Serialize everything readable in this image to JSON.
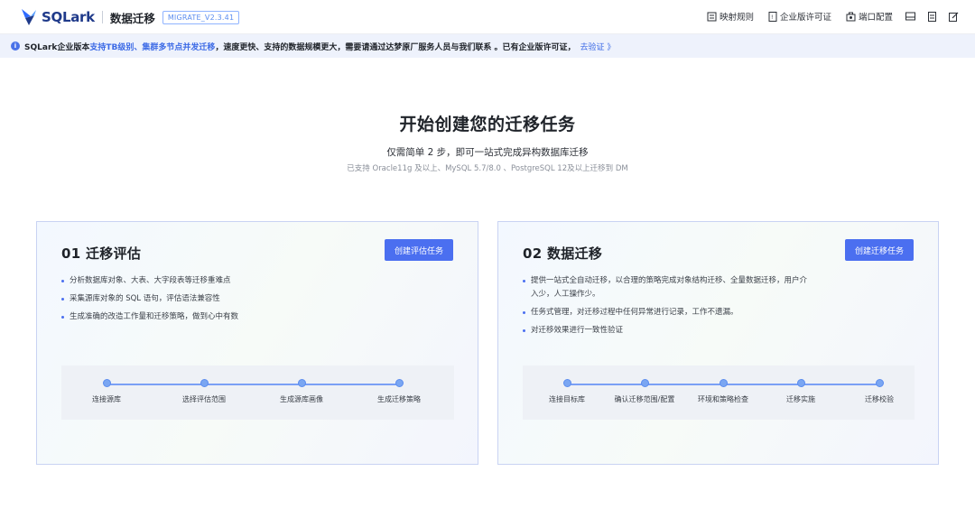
{
  "header": {
    "logo_text": "SQLark",
    "product_name": "数据迁移",
    "version": "MIGRATE_V2.3.41",
    "actions": [
      {
        "label": "映射规则",
        "icon": "mapping-rules-icon"
      },
      {
        "label": "企业版许可证",
        "icon": "license-icon"
      },
      {
        "label": "端口配置",
        "icon": "port-config-icon"
      }
    ],
    "icon_actions": [
      "storage-icon",
      "document-icon",
      "edit-icon"
    ]
  },
  "banner": {
    "prefix": "SQLark企业版本",
    "highlight": "支持TB级别、集群多节点并发迁移",
    "middle": "，速度更快、支持的数据规模更大，需要请通过达梦原厂服务人员与我们联系 。已有企业版许可证，",
    "link": "去验证 》"
  },
  "hero": {
    "title": "开始创建您的迁移任务",
    "subtitle": "仅需简单 2 步，即可一站式完成异构数据库迁移",
    "note": "已支持 Oracle11g 及以上、MySQL 5.7/8.0 、PostgreSQL 12及以上迁移到 DM"
  },
  "cards": [
    {
      "title": "01 迁移评估",
      "button": "创建评估任务",
      "bullets": [
        "分析数据库对象、大表、大字段表等迁移重难点",
        "采集源库对象的 SQL 语句，评估语法兼容性",
        "生成准确的改造工作量和迁移策略，做到心中有数"
      ],
      "steps": [
        "连接源库",
        "选择评估范围",
        "生成源库画像",
        "生成迁移策略"
      ]
    },
    {
      "title": "02 数据迁移",
      "button": "创建迁移任务",
      "bullets": [
        "提供一站式全自动迁移，以合理的策略完成对象结构迁移、全量数据迁移，用户介入少，人工操作少。",
        "任务式管理，对迁移过程中任何异常进行记录，工作不遗漏。",
        "对迁移效果进行一致性验证"
      ],
      "steps": [
        "连接目标库",
        "确认迁移范围/配置",
        "环境和策略检查",
        "迁移实施",
        "迁移校验"
      ]
    }
  ],
  "colors": {
    "accent": "#4b6ff0",
    "banner_bg": "#eef2fc",
    "highlight": "#3d6be6"
  }
}
